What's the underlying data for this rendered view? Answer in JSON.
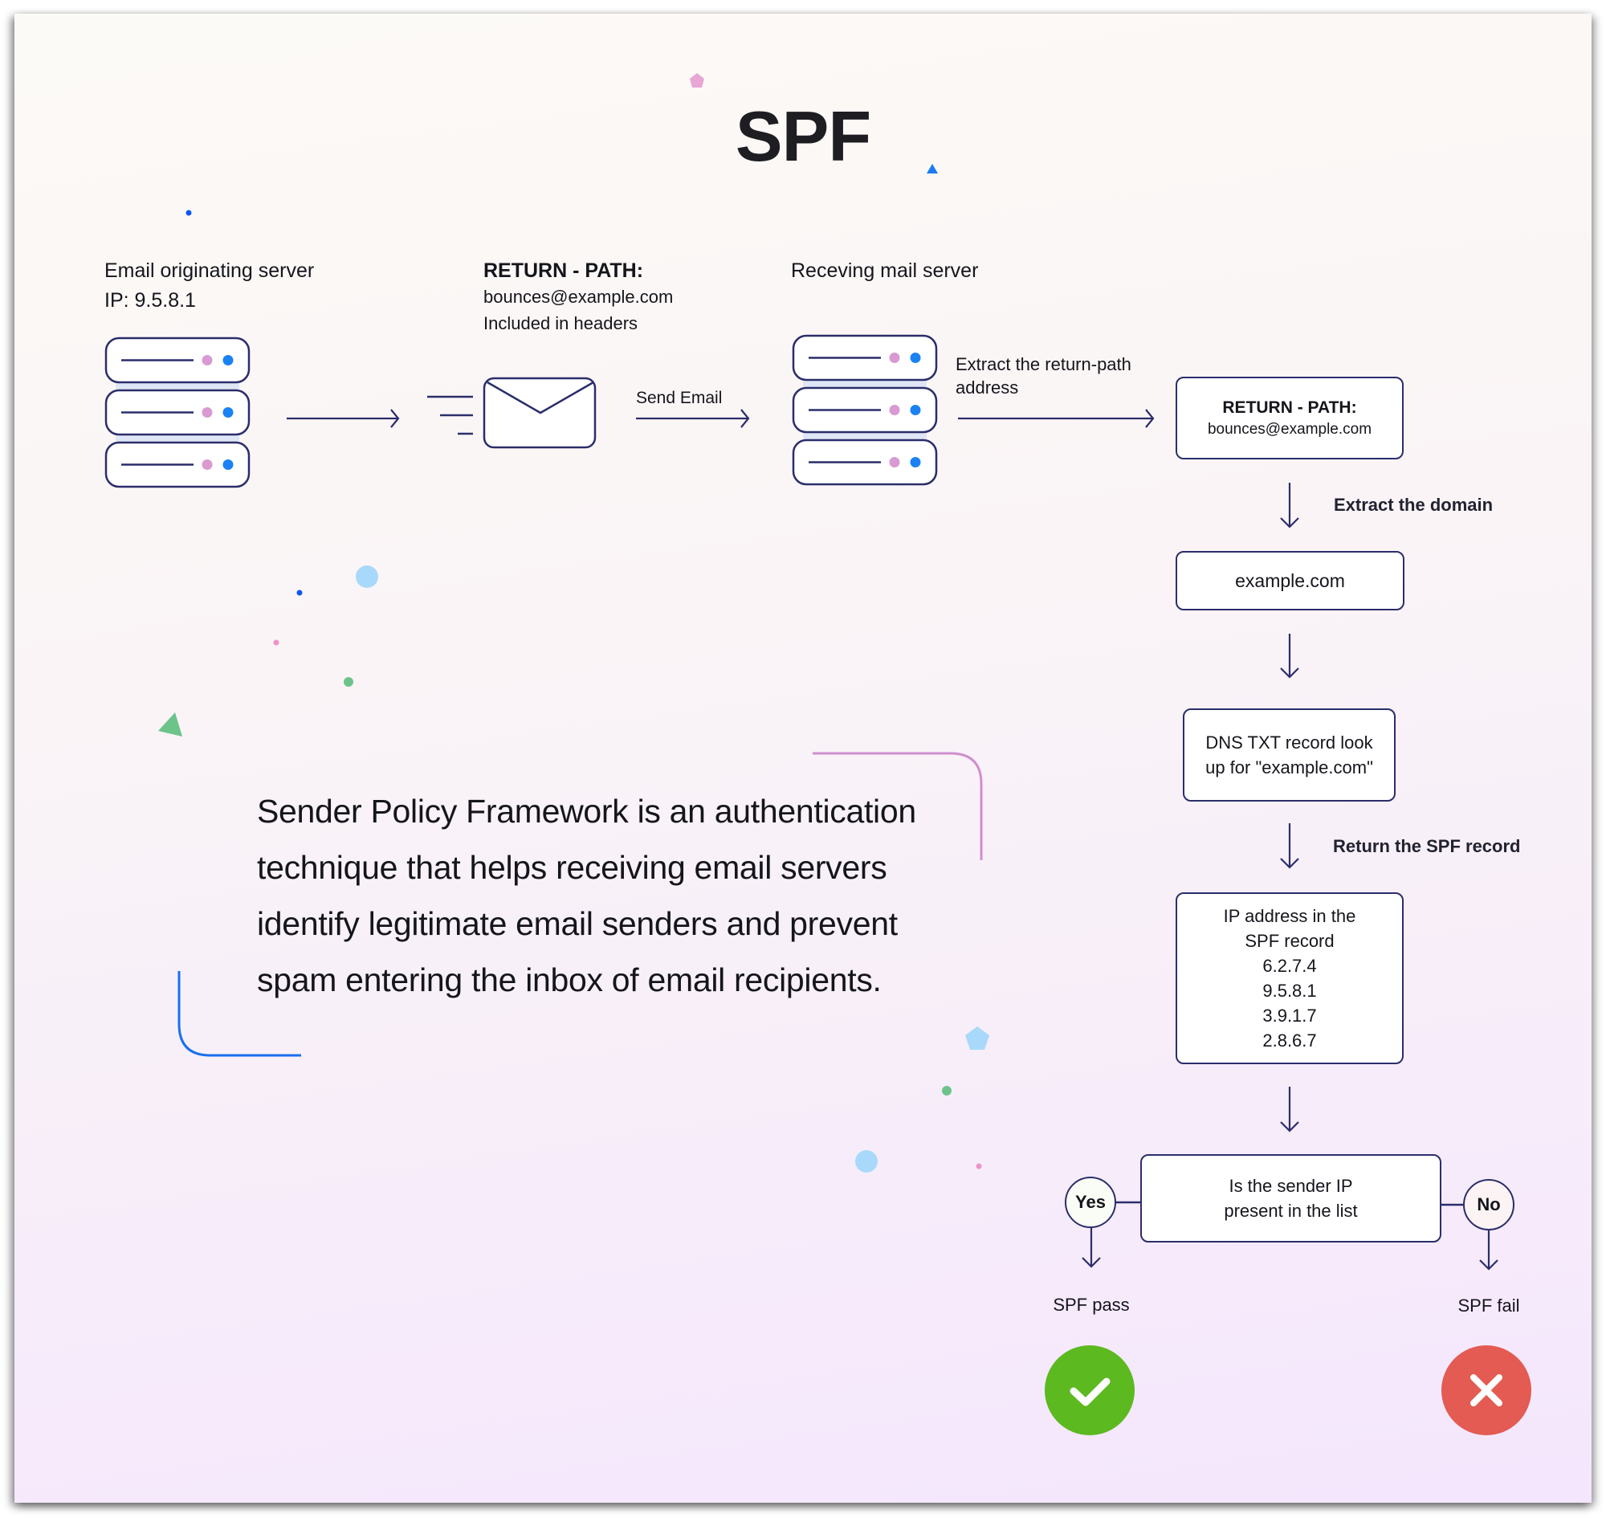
{
  "title": "SPF",
  "origin": {
    "heading": "Email originating server",
    "ip": "IP: 9.5.8.1"
  },
  "return_path_note": {
    "heading": "RETURN - PATH:",
    "address": "bounces@example.com",
    "note": "Included in headers"
  },
  "send_email_label": "Send Email",
  "receiver": {
    "heading": "Receving mail server",
    "extract_label_line1": "Extract the return-path",
    "extract_label_line2": "address"
  },
  "flow": {
    "return_path_box": {
      "heading": "RETURN - PATH:",
      "address": "bounces@example.com"
    },
    "extract_domain_label": "Extract the domain",
    "domain_box": "example.com",
    "dns_box": {
      "line1": "DNS TXT record look",
      "line2": "up for \"example.com\""
    },
    "return_spf_label": "Return the SPF record",
    "ip_box": {
      "line1": "IP address in the",
      "line2": "SPF record",
      "ips": [
        "6.2.7.4",
        "9.5.8.1",
        "3.9.1.7",
        "2.8.6.7"
      ]
    },
    "decision_box": {
      "line1": "Is the sender IP",
      "line2": "present in the list"
    },
    "yes_label": "Yes",
    "no_label": "No",
    "pass_label": "SPF pass",
    "fail_label": "SPF fail"
  },
  "description": [
    "Sender Policy Framework is an authentication",
    "technique that helps receiving email servers",
    "identify legitimate email senders and prevent",
    "spam entering the inbox of email recipients."
  ],
  "icons": {
    "server": "server-stack-icon",
    "envelope": "envelope-icon",
    "pass": "checkmark-icon",
    "fail": "x-icon"
  },
  "colors": {
    "stroke": "#2b2d6b",
    "server_dot_pink": "#d89ad0",
    "server_dot_blue": "#1a82f5",
    "pass_green": "#5cb920",
    "fail_red": "#e35b52",
    "bracket_pink": "#cf8fcf",
    "bracket_blue": "#1a6ff0"
  }
}
